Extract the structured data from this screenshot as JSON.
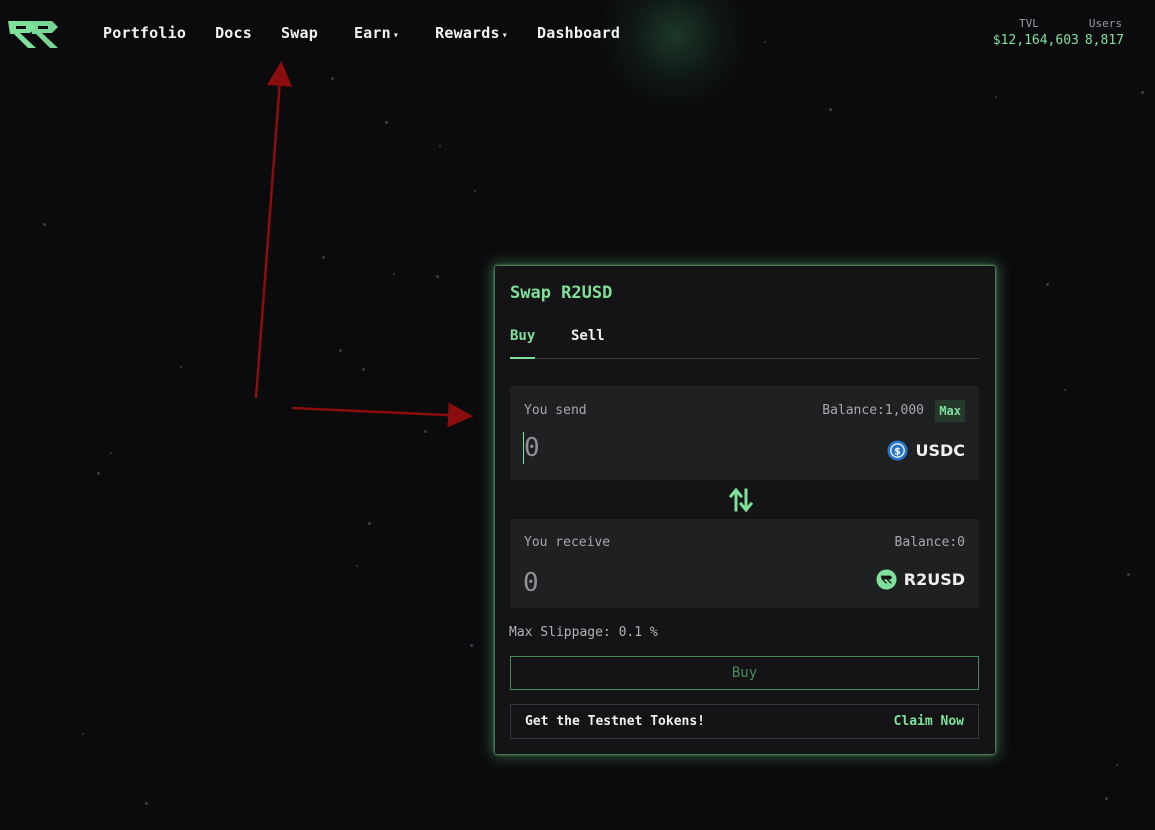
{
  "header": {
    "logo_icon": "r2-logo-icon",
    "nav": [
      {
        "label": "Portfolio"
      },
      {
        "label": "Docs"
      },
      {
        "label": "Swap"
      },
      {
        "label": "Earn",
        "caret": "▾"
      },
      {
        "label": "Rewards",
        "caret": "▾"
      },
      {
        "label": "Dashboard"
      }
    ],
    "stats": {
      "tvl_label": "TVL",
      "tvl_value": "$12,164,603",
      "users_label": "Users",
      "users_value": "8,817"
    }
  },
  "swap": {
    "title": "Swap R2USD",
    "tabs": [
      "Buy",
      "Sell"
    ],
    "active_tab": "Buy",
    "send": {
      "label": "You send",
      "balance": "Balance:1,000",
      "max_label": "Max",
      "placeholder": "0",
      "token": "USDC",
      "token_icon": "usdc-icon"
    },
    "direction_icon": "swap-arrows-icon",
    "receive": {
      "label": "You receive",
      "balance": "Balance:0",
      "placeholder": "0",
      "token": "R2USD",
      "token_icon": "r2usd-icon"
    },
    "slippage": "Max Slippage: 0.1 %",
    "buy_button": "Buy",
    "testnet_text": "Get the Testnet Tokens!",
    "claim_label": "Claim Now"
  },
  "colors": {
    "accent": "#7fe09b",
    "background": "#0b0b0e",
    "card": "#141416",
    "annotation_arrow": "#8b0d0d"
  }
}
